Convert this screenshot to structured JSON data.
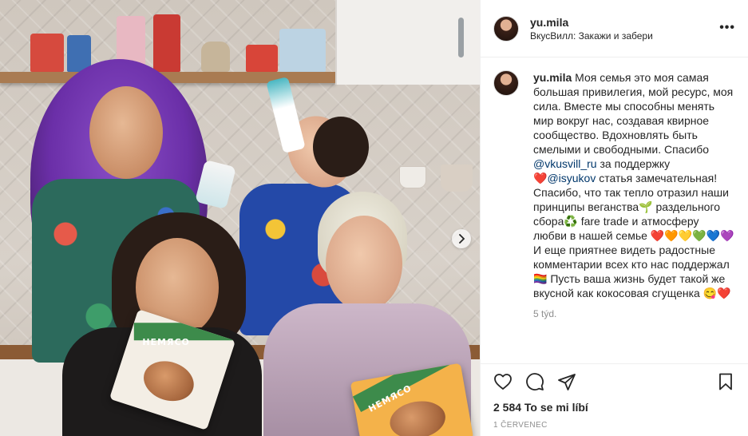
{
  "post": {
    "username": "yu.mila",
    "location": "ВкусВилл: Закажи и забери",
    "more_label": "•••",
    "caption_username": "yu.mila",
    "caption_parts": {
      "p1": "Моя семья это моя самая большая привилегия, мой ресурс, моя сила. Вместе мы способны менять мир вокруг нас, создавая квирное сообщество. Вдохновлять быть смелыми и свободными. Спасибо",
      "mention1": "@vkusvill_ru",
      "p2": "за поддержку",
      "heart_red": "❤️",
      "mention2": "@isyukov",
      "p3": "статья замечательная! Спасибо, что так тепло отразил наши принципы веганства🌱 раздельного сбора♻️ fare trade и атмосферу любви в нашей семье ❤️🧡💛💚💙💜 И еще приятнее видеть радостные комментарии всех кто нас поддержал🏳️‍🌈 Пусть ваша жизнь будет такой же вкусной как кокосовая сгущенка 😋❤️"
    },
    "time_ago": "5 týd.",
    "likes": "2 584 To se mi líbí",
    "date": "1 ČERVENEC"
  },
  "media": {
    "package_label": "НЕМЯСО"
  },
  "icons": {
    "like": "heart-icon",
    "comment": "comment-icon",
    "share": "paper-plane-icon",
    "save": "bookmark-icon",
    "next": "chevron-right-icon",
    "more": "more-dots-icon"
  }
}
